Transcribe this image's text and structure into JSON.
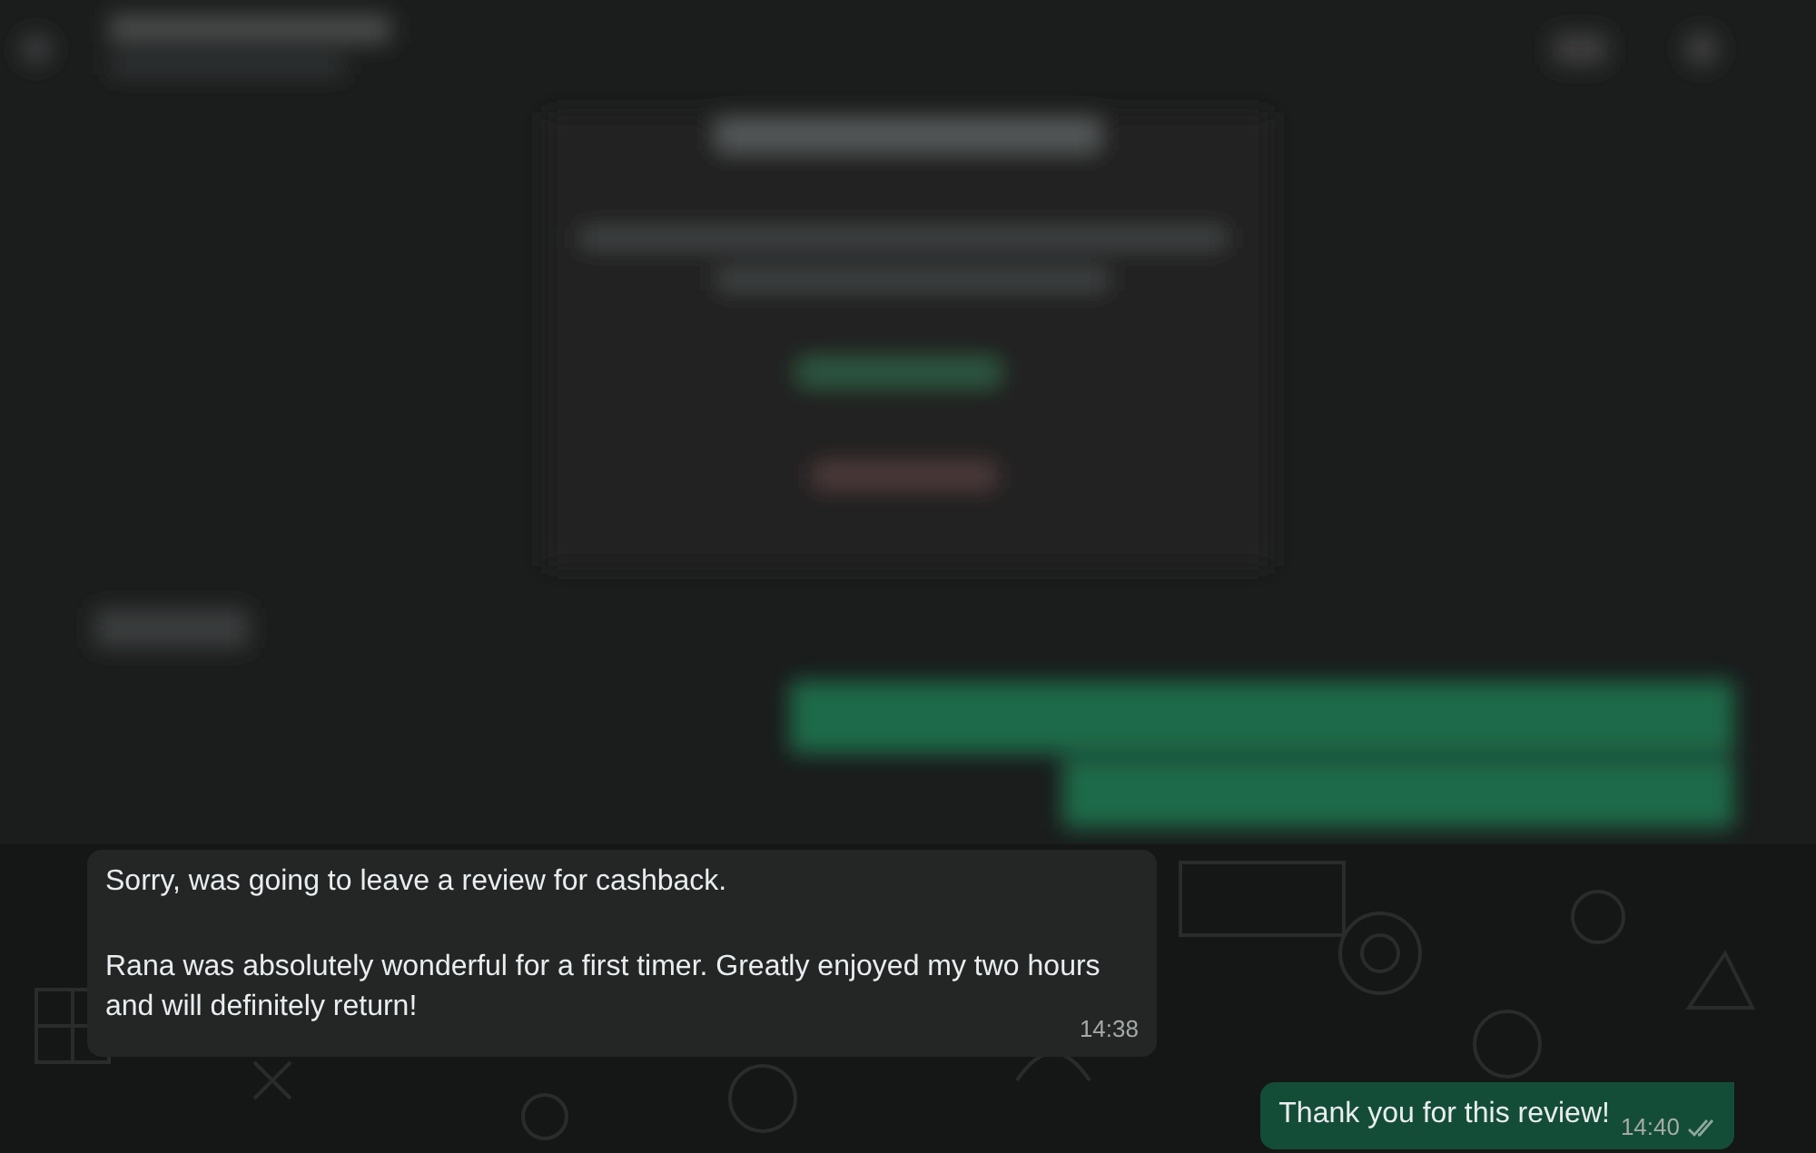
{
  "messages": [
    {
      "kind": "incoming",
      "paragraphs": [
        "Sorry, was going to leave a review for cashback.",
        "Rana was absolutely wonderful for a first timer. Greatly enjoyed my two hours and will definitely return!"
      ],
      "time": "14:38"
    },
    {
      "kind": "outgoing",
      "paragraphs": [
        "Thank you for this review!"
      ],
      "time": "14:40",
      "read": false
    }
  ]
}
